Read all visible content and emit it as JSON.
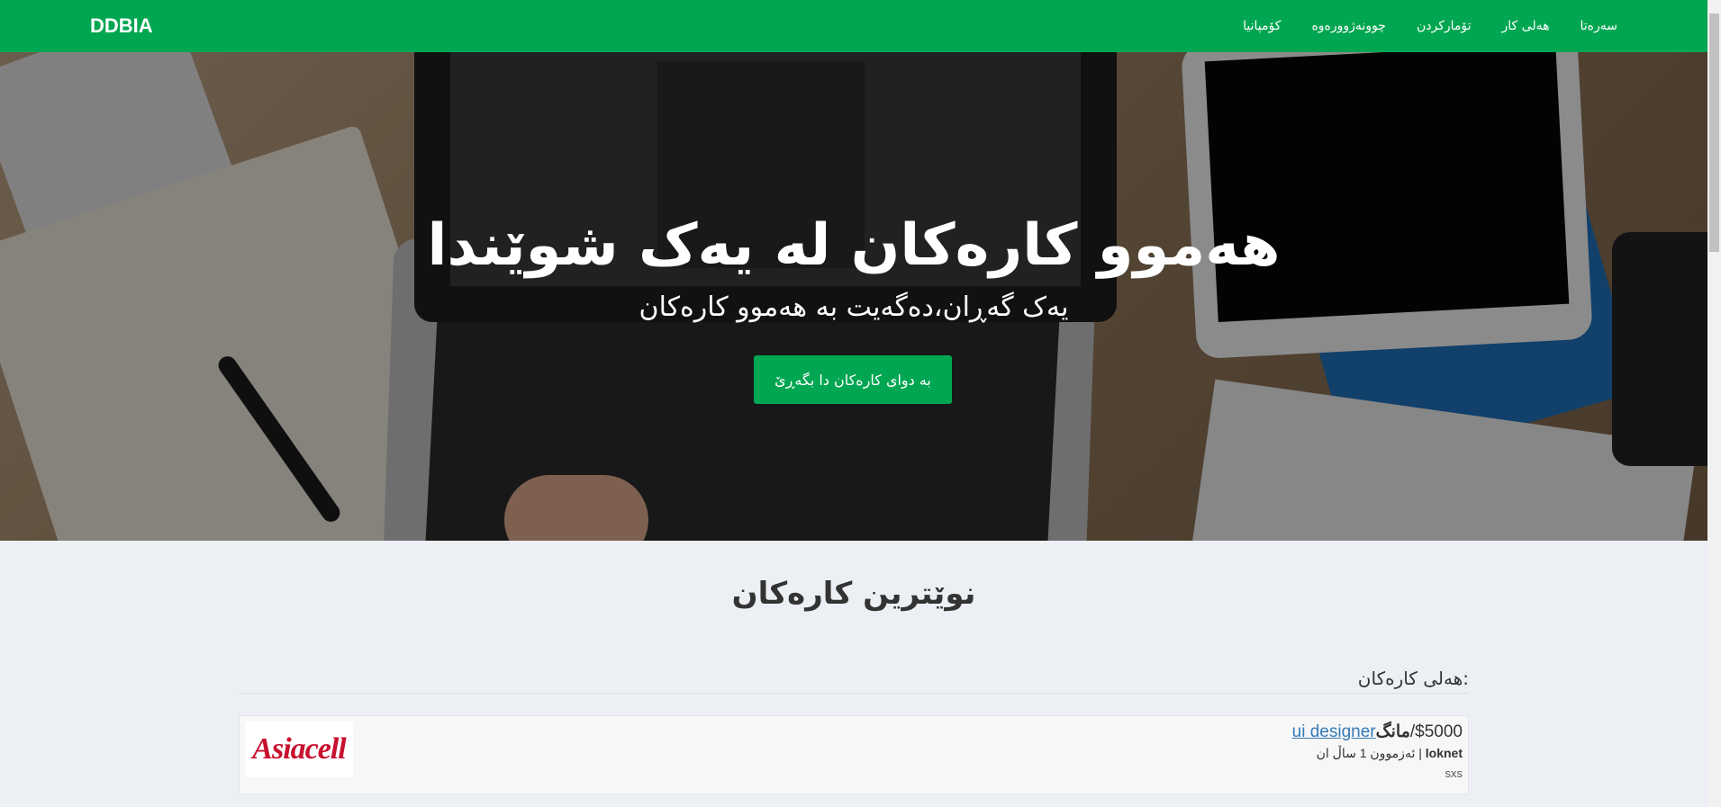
{
  "navbar": {
    "brand": "DDBIA",
    "links": [
      "سەرەتا",
      "هەلی کار",
      "تۆمارکردن",
      "چوونەژوورەوە",
      "کۆمپانیا"
    ]
  },
  "hero": {
    "title": "هەموو کارەکان لە یەک شوێندا",
    "subtitle": "یەک گەڕان،دەگەیت بە هەموو کارەکان",
    "button_label": "بە دوای کارەکان دا بگەڕێ"
  },
  "section": {
    "title": "نوێترین کارەکان"
  },
  "jobs": {
    "heading": "هەلی کارەکان:",
    "items": [
      {
        "title": "ui designer",
        "salary": "$5000/",
        "period": "مانگ",
        "company": "loknet",
        "experience": "| ئەزموون 1 ساڵ  ان",
        "location": "sxs",
        "logo_text": "Asiacell"
      }
    ]
  }
}
